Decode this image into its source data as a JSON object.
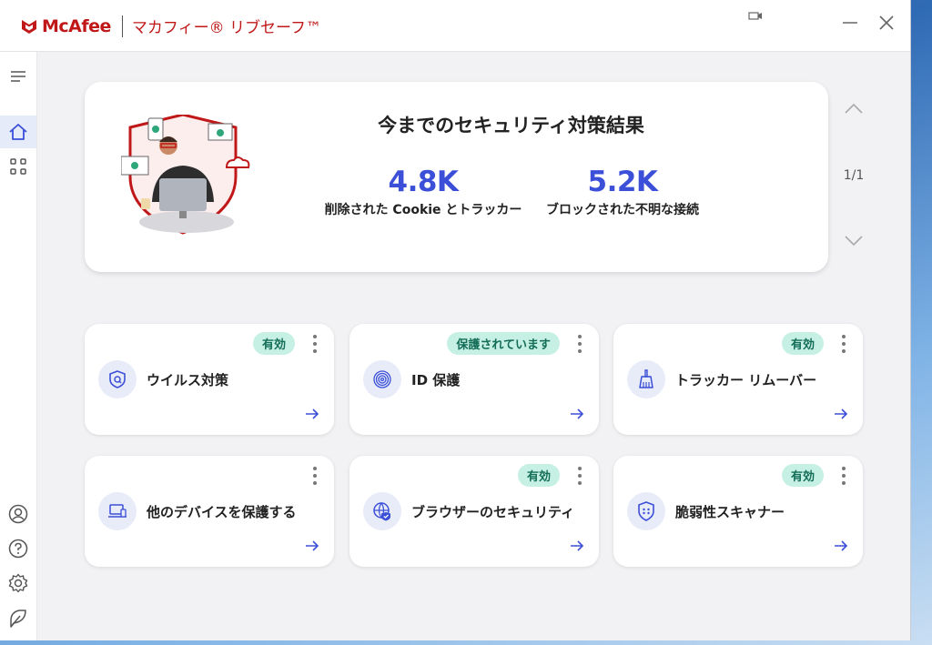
{
  "titlebar": {
    "brand": "McAfee",
    "product": "マカフィー® リブセーフ™"
  },
  "hero": {
    "title": "今までのセキュリティ対策結果",
    "stats": [
      {
        "value": "4.8K",
        "label": "削除された Cookie とトラッカー"
      },
      {
        "value": "5.2K",
        "label": "ブロックされた不明な接続"
      }
    ],
    "pager": "1/1"
  },
  "cards": [
    {
      "label": "ウイルス対策",
      "badge": "有効",
      "icon": "shield-search-icon"
    },
    {
      "label": "ID 保護",
      "badge": "保護されています",
      "icon": "fingerprint-icon"
    },
    {
      "label": "トラッカー リムーバー",
      "badge": "有効",
      "icon": "broom-icon"
    },
    {
      "label": "他のデバイスを保護する",
      "badge": "",
      "icon": "laptop-icon"
    },
    {
      "label": "ブラウザーのセキュリティ",
      "badge": "有効",
      "icon": "globe-shield-icon"
    },
    {
      "label": "脆弱性スキャナー",
      "badge": "有効",
      "icon": "shield-dots-icon"
    }
  ],
  "colors": {
    "brand_red": "#c01818",
    "stat_blue": "#3b4fd8",
    "badge_bg": "#c7f0e5",
    "badge_text": "#136d57"
  }
}
